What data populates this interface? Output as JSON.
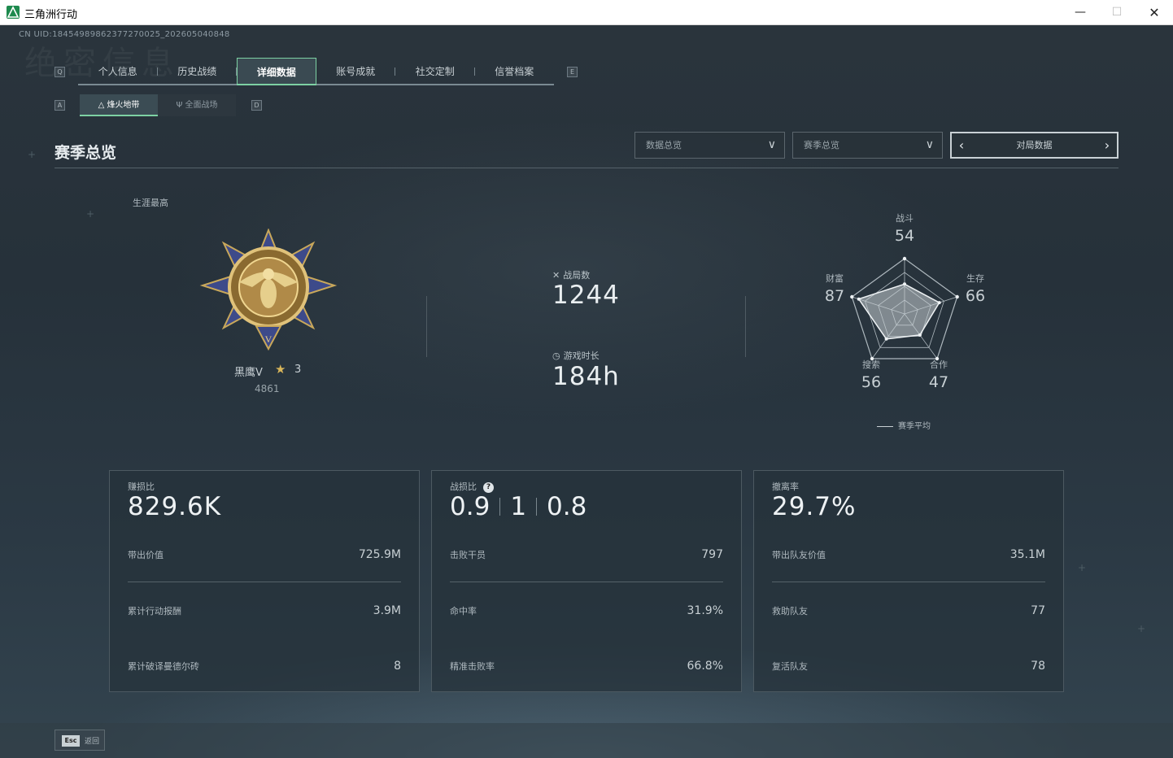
{
  "window": {
    "title": "三角洲行动",
    "min_icon": "minimize-icon",
    "max_icon": "maximize-icon",
    "close_icon": "close-icon"
  },
  "uid": "CN UID:18454989862377270025_202605040848",
  "ghost_text": "绝密信息",
  "key_hints": {
    "prev_tab": "Q",
    "next_tab": "E",
    "prev_sub": "A",
    "next_sub": "D"
  },
  "tabs": [
    {
      "label": "个人信息"
    },
    {
      "label": "历史战绩"
    },
    {
      "label": "详细数据",
      "active": true
    },
    {
      "label": "账号成就"
    },
    {
      "label": "社交定制"
    },
    {
      "label": "信誉档案"
    }
  ],
  "subtabs": [
    {
      "label": "烽火地带",
      "icon": "flame-zone-icon",
      "active": true
    },
    {
      "label": "全面战场",
      "icon": "battlefield-icon"
    }
  ],
  "section": {
    "title": "赛季总览"
  },
  "filters": {
    "data_overview": "数据总览",
    "season_overview": "赛季总览"
  },
  "pager": {
    "label": "对局数据"
  },
  "career": {
    "label": "生涯最高",
    "rank_name": "黑鹰V",
    "rank_stars": "3",
    "rank_score": "4861",
    "medal_icon": "black-hawk-medal-icon"
  },
  "summary": {
    "matches_label": "战局数",
    "matches_value": "1244",
    "playtime_label": "游戏时长",
    "playtime_value": "184h"
  },
  "radar": {
    "labels": {
      "combat": "战斗",
      "survival": "生存",
      "cooperation": "合作",
      "search": "搜索",
      "wealth": "财富"
    },
    "values": {
      "combat": "54",
      "survival": "66",
      "cooperation": "47",
      "search": "56",
      "wealth": "87"
    },
    "legend": "赛季平均"
  },
  "chart_data": {
    "type": "radar",
    "categories": [
      "战斗",
      "生存",
      "合作",
      "搜索",
      "财富"
    ],
    "values": [
      54,
      66,
      47,
      56,
      87
    ],
    "ylim": [
      0,
      100
    ],
    "legend": "赛季平均"
  },
  "cards": [
    {
      "label": "赚损比",
      "big": "829.6K",
      "rows": [
        {
          "k": "带出价值",
          "v": "725.9M"
        },
        {
          "k": "累计行动报酬",
          "v": "3.9M"
        },
        {
          "k": "累计破译曼德尔砖",
          "v": "8"
        }
      ]
    },
    {
      "label": "战损比",
      "kd": [
        "0.9",
        "1",
        "0.8"
      ],
      "rows": [
        {
          "k": "击败干员",
          "v": "797"
        },
        {
          "k": "命中率",
          "v": "31.9%"
        },
        {
          "k": "精准击败率",
          "v": "66.8%"
        }
      ]
    },
    {
      "label": "撤离率",
      "big": "29.7%",
      "rows": [
        {
          "k": "带出队友价值",
          "v": "35.1M"
        },
        {
          "k": "救助队友",
          "v": "77"
        },
        {
          "k": "复活队友",
          "v": "78"
        }
      ]
    }
  ],
  "footer": {
    "esc_key": "Esc",
    "back_label": "返回"
  }
}
